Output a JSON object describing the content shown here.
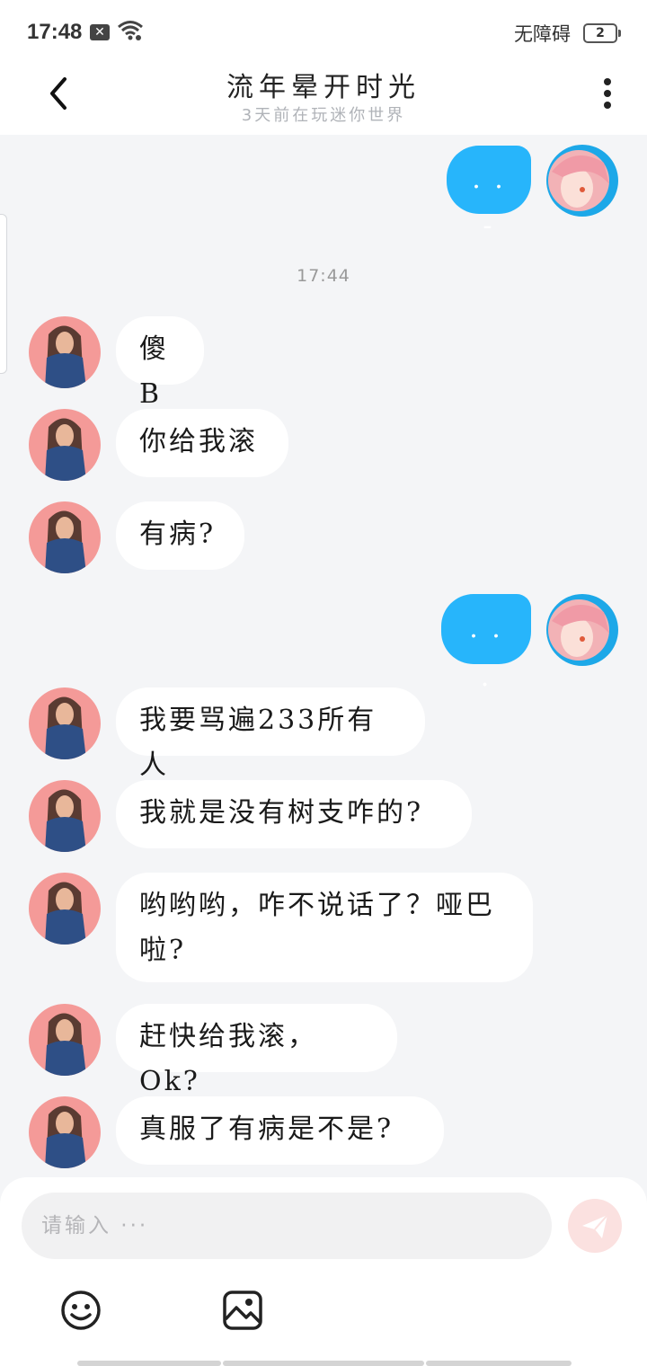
{
  "status_bar": {
    "time": "17:48",
    "notification_badge": "✕",
    "accessibility_label": "无障碍",
    "battery_level": "2"
  },
  "header": {
    "title": "流年晕开时光",
    "subtitle": "3天前在玩迷你世界"
  },
  "chat": {
    "messages": [
      {
        "from": "me",
        "text": ". . -"
      },
      {
        "timestamp": "17:44"
      },
      {
        "from": "friend",
        "text": "傻B"
      },
      {
        "from": "friend",
        "text": "你给我滚"
      },
      {
        "from": "friend",
        "text": "有病?"
      },
      {
        "from": "me",
        "text": ". . ."
      },
      {
        "from": "friend",
        "text": "我要骂遍233所有人"
      },
      {
        "from": "friend",
        "text": "我就是没有树支咋的?"
      },
      {
        "from": "friend",
        "text": "哟哟哟，咋不说话了？哑巴啦?"
      },
      {
        "from": "friend",
        "text": "赶快给我滚，Ok?"
      },
      {
        "from": "friend",
        "text": "真服了有病是不是?"
      }
    ]
  },
  "composer": {
    "placeholder": "请输入 ···",
    "send_icon": "paper-plane-icon",
    "emoji_icon": "smiley-icon",
    "image_icon": "image-icon"
  },
  "colors": {
    "my_bubble": "#27b5fb",
    "friend_bubble": "#ffffff",
    "background": "#f4f5f7",
    "send_button": "#fbe1e0"
  }
}
